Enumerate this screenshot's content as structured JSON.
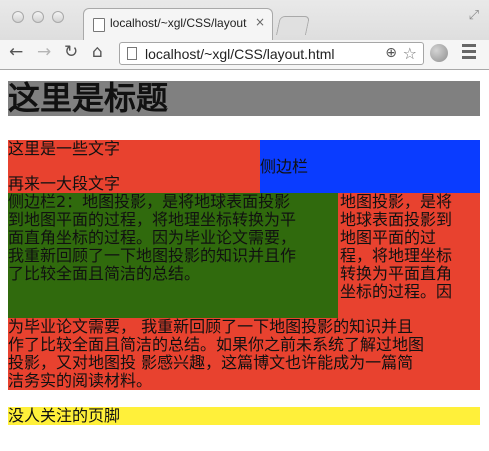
{
  "browser": {
    "tab_title": "localhost/~xgl/CSS/layout",
    "tab_close": "×",
    "url": "localhost/~xgl/CSS/layout.html",
    "icons": [
      "back-icon",
      "forward-icon",
      "reload-icon",
      "home-icon",
      "page-icon",
      "zoom-icon",
      "star-icon",
      "globe-icon",
      "menu-icon",
      "fullscreen-icon"
    ]
  },
  "page": {
    "header": "这里是标题",
    "main": {
      "line1": "这里是一些文字",
      "line2": "再来一大段文字"
    },
    "sidebar1": "侧边栏",
    "sidebar2": "侧边栏2：地图投影，是将地球表面投影\n到地图平面的过程，将地理坐标转换为平\n面直角坐标的过程。因为毕业论文需要，\n我重新回顾了一下地图投影的知识并且作\n了比较全面且简洁的总结。",
    "flow_right": "地图投影，是将\n地球表面投影到\n地图平面的过\n程，将地理坐标\n转换为平面直角\n坐标的过程。因",
    "flow_bottom": "为毕业论文需要， 我重新回顾了一下地图投影的知识并且\n作了比较全面且简洁的总结。如果你之前未系统了解过地图\n投影，又对地图投 影感兴趣，这篇博文也许能成为一篇简\n洁务实的阅读材料。",
    "footer": "没人关注的页脚"
  },
  "colors": {
    "header_bg": "#808080",
    "main_bg": "#e8422f",
    "sidebar1_bg": "#0a3cff",
    "sidebar2_bg": "#306a0d",
    "footer_bg": "#fff03a"
  }
}
